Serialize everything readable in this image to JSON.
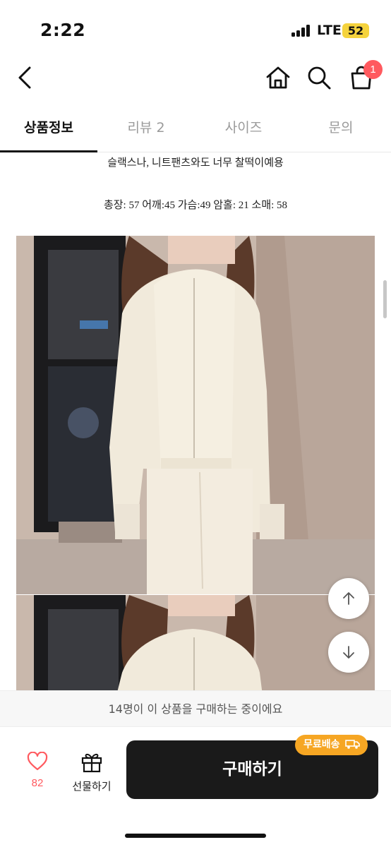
{
  "status_bar": {
    "time": "2:22",
    "network": "LTE",
    "battery": "52",
    "battery_color": "#f5d33d"
  },
  "header": {
    "icons": [
      "back-icon",
      "home-icon",
      "search-icon",
      "cart-icon"
    ],
    "cart_badge": "1",
    "badge_color": "#ff5a5f"
  },
  "tabs": [
    {
      "label": "상품정보",
      "active": true
    },
    {
      "label": "리뷰 2",
      "active": false
    },
    {
      "label": "사이즈",
      "active": false
    },
    {
      "label": "문의",
      "active": false
    }
  ],
  "description": {
    "line1": "슬랙스나, 니트팬츠와도 너무 찰떡이예용",
    "line2": "총장: 57 어깨:45 가슴:49 암홀: 21 소매: 58"
  },
  "scroll_buttons": [
    "arrow-up-icon",
    "arrow-down-icon"
  ],
  "notice": {
    "text": "14명이 이 상품을 구매하는 중이에요"
  },
  "bottom_bar": {
    "like_count": "82",
    "gift_label": "선물하기",
    "buy_label": "구매하기",
    "free_shipping_label": "무료배송",
    "accent_color": "#f6a623",
    "buy_button_color": "#1a1a1a"
  }
}
